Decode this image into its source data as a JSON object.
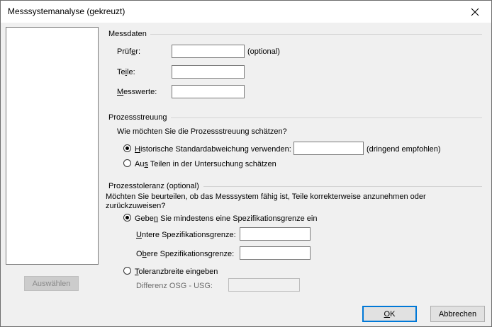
{
  "window": {
    "title": "Messsystemanalyse (gekreuzt)",
    "close_icon": "close-icon"
  },
  "left": {
    "select_button": "Auswählen"
  },
  "messdaten": {
    "heading": "Messdaten",
    "pruefer": {
      "label_pre": "Prüf",
      "label_key": "e",
      "label_post": "r:",
      "value": "",
      "note": "(optional)"
    },
    "teile": {
      "label_pre": "Te",
      "label_key": "i",
      "label_post": "le:",
      "value": ""
    },
    "messwerte": {
      "label_pre": "",
      "label_key": "M",
      "label_post": "esswerte:",
      "value": ""
    }
  },
  "prozessstreuung": {
    "heading": "Prozessstreuung",
    "question": "Wie möchten Sie die Prozessstreuung schätzen?",
    "option1": {
      "label_pre": "",
      "label_key": "H",
      "label_post": "istorische Standardabweichung verwenden:",
      "value": "",
      "note": "(dringend empfohlen)",
      "checked": true
    },
    "option2": {
      "label_pre": "Au",
      "label_key": "s",
      "label_post": " Teilen in der Untersuchung schätzen",
      "checked": false
    }
  },
  "prozesstoleranz": {
    "heading": "Prozesstoleranz (optional)",
    "question_line1": "Möchten Sie beurteilen, ob das Messsystem fähig ist, Teile korrekterweise anzunehmen oder",
    "question_line2": "zurückzuweisen?",
    "option1": {
      "label_pre": "Gebe",
      "label_key": "n",
      "label_post": " Sie mindestens eine Spezifikationsgrenze ein",
      "checked": true
    },
    "usg": {
      "label_pre": "",
      "label_key": "U",
      "label_post": "ntere Spezifikationsgrenze:",
      "value": ""
    },
    "osg": {
      "label_pre": "O",
      "label_key": "b",
      "label_post": "ere Spezifikationsgrenze:",
      "value": ""
    },
    "option2": {
      "label_pre": "",
      "label_key": "T",
      "label_post": "oleranzbreite eingeben",
      "checked": false
    },
    "differenz": {
      "label": "Differenz OSG - USG:",
      "value": ""
    }
  },
  "footer": {
    "ok_pre": "",
    "ok_key": "O",
    "ok_post": "K",
    "cancel": "Abbrechen"
  }
}
